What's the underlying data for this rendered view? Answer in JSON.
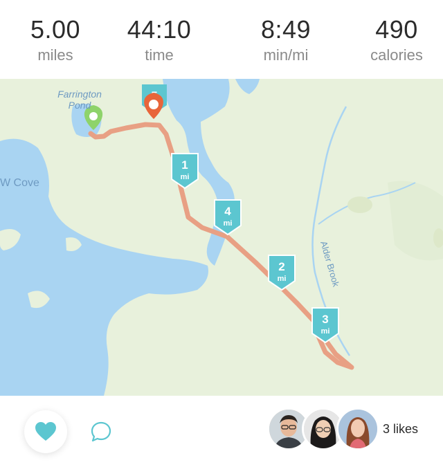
{
  "stats": [
    {
      "value": "5.00",
      "label": "miles"
    },
    {
      "value": "44:10",
      "label": "time"
    },
    {
      "value": "8:49",
      "label": "min/mi"
    },
    {
      "value": "490",
      "label": "calories"
    }
  ],
  "map": {
    "labels": {
      "pond": [
        "Farrington",
        "Pond"
      ],
      "cove": "W Cove",
      "brook": "Alder Brook"
    },
    "mile_markers": [
      {
        "number": "1",
        "unit": "mi"
      },
      {
        "number": "2",
        "unit": "mi"
      },
      {
        "number": "3",
        "unit": "mi"
      },
      {
        "number": "4",
        "unit": "mi"
      },
      {
        "number": "5",
        "unit": ""
      }
    ],
    "colors": {
      "land": "#e8f1dc",
      "water": "#a9d4f2",
      "route": "#e8a084",
      "marker": "#5cc6d0",
      "start_pin": "#8ed36a",
      "end_pin": "#e8653a"
    }
  },
  "social": {
    "like_icon": "heart-icon",
    "comment_icon": "comment-icon",
    "avatars": [
      "avatar-1",
      "avatar-2",
      "avatar-3"
    ],
    "likes_text": "3 likes",
    "accent": "#5cc6d0"
  }
}
